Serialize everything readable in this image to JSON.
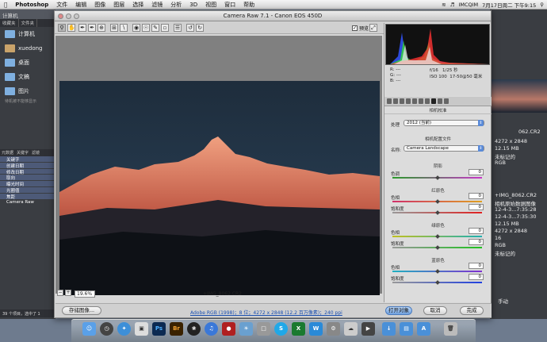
{
  "menubar": {
    "apple": "",
    "items": [
      "Photoshop",
      "文件",
      "编辑",
      "图像",
      "图层",
      "选择",
      "滤镜",
      "分析",
      "3D",
      "视图",
      "窗口",
      "帮助"
    ],
    "right": {
      "user": "IMCQIM",
      "clock": "7月17日周二 下午9:15"
    }
  },
  "background_left": {
    "header": "计算机",
    "tabs": [
      "收藏夹",
      "文件夹"
    ],
    "sidebar": [
      "计算机",
      "xuedong",
      "桌面",
      "文稿",
      "图片"
    ],
    "search_hint": "待机被不能够显示",
    "panel_tabs": [
      "元数据",
      "关键字",
      "滤镜"
    ],
    "list": [
      "关键字",
      "创建日期",
      "修改日期",
      "取向",
      "曝光时间",
      "光圈值",
      "焦距",
      "Camera Raw"
    ],
    "status": "39 个项目，选中了 1"
  },
  "background_right": {
    "lines_top": [
      "4272 x 2848",
      "12.15 MB",
      "未标记的",
      "RGB"
    ],
    "lines_bottom": [
      "+IMG_8062.CR2",
      "相机原始数据图像",
      "12-4-3...7:35:28",
      "12-4-3...7:35:30",
      "12.15 MB",
      "4272 x 2848",
      "16",
      "RGB",
      "未标记的"
    ],
    "bottom_label": "手动",
    "filename_short": "062.CR2"
  },
  "dialog": {
    "title": "Camera Raw 7.1 - Canon EOS 450D",
    "preview_label": "预览",
    "zoom": "19.6%",
    "filename": "+IMG_8062.CR2",
    "workflow": "Adobe RGB (1998)；8 位；4272 x 2848 (12.2 百万像素)；240 ppi",
    "buttons": {
      "save": "存储图像...",
      "open": "打开对象",
      "cancel": "取消",
      "done": "完成"
    }
  },
  "info": {
    "r": "R:",
    "g": "G:",
    "b": "B:",
    "r_val": "---",
    "g_val": "---",
    "b_val": "---",
    "aperture": "f/16",
    "shutter": "1/25 秒",
    "iso": "ISO 100",
    "lens": "17-50@50 毫米"
  },
  "panel": {
    "title": "相机校准",
    "process_label": "处理",
    "process_value": "2012 (当前)",
    "profile_section": "相机配置文件",
    "profile_label": "名称:",
    "profile_value": "Camera Landscape",
    "shadows_section": "阴影",
    "shadows_tint_label": "色调",
    "shadows_tint": "0",
    "red_section": "红原色",
    "red_hue_label": "色相",
    "red_hue": "0",
    "red_sat_label": "饱和度",
    "red_sat": "0",
    "green_section": "绿原色",
    "green_hue_label": "色相",
    "green_hue": "0",
    "green_sat_label": "饱和度",
    "green_sat": "0",
    "blue_section": "蓝原色",
    "blue_hue_label": "色相",
    "blue_hue": "0",
    "blue_sat_label": "饱和度",
    "blue_sat": "0"
  },
  "dock": {
    "icons": [
      "finder-icon",
      "dashboard-icon",
      "safari-icon",
      "preview-icon",
      "photoshop-icon",
      "bridge-icon",
      "aperture-icon",
      "itunes-icon",
      "photo-booth-icon",
      "iphoto-icon",
      "skype-icon",
      "excel-icon",
      "system-prefs-icon",
      "trash-icon"
    ],
    "ps": "Ps",
    "br": "Br"
  }
}
